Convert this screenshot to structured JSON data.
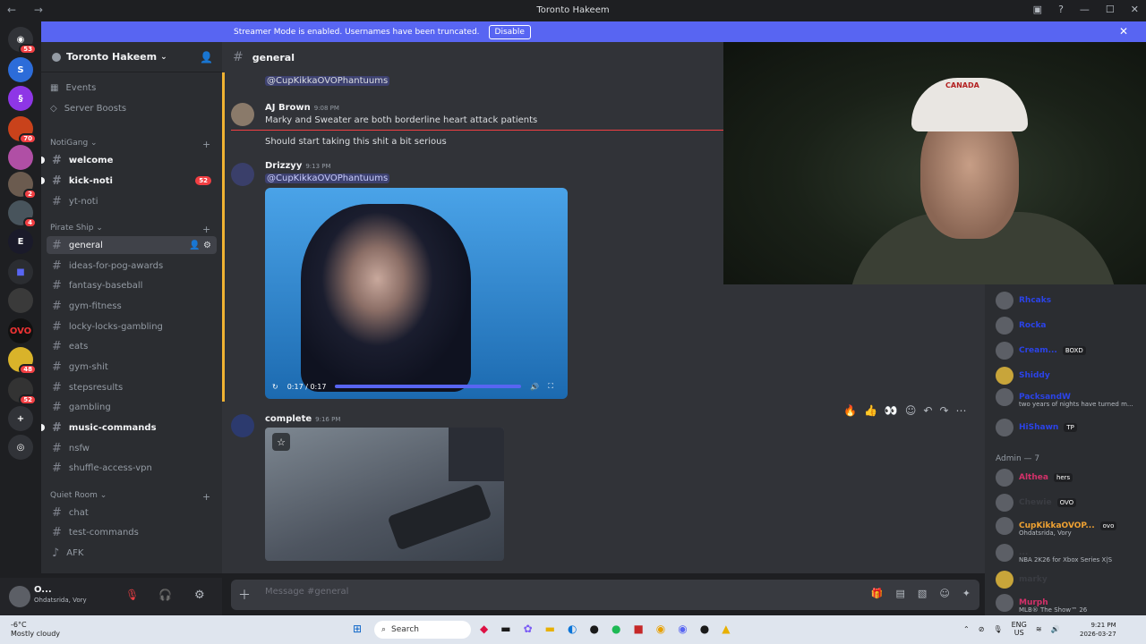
{
  "window": {
    "title": "Toronto Hakeem"
  },
  "banner": {
    "text": "Streamer Mode is enabled. Usernames have been truncated.",
    "button": "Disable"
  },
  "rail": {
    "badges": [
      "53",
      "70",
      "2",
      "4",
      "48",
      "52"
    ]
  },
  "sidebar": {
    "server_name": "Toronto Hakeem",
    "top_items": [
      "Events",
      "Server Boosts"
    ],
    "categories": [
      {
        "name": "NotiGang",
        "channels": [
          {
            "name": "welcome",
            "unread": true
          },
          {
            "name": "kick-noti",
            "unread": true,
            "badge": "52"
          },
          {
            "name": "yt-noti"
          }
        ]
      },
      {
        "name": "Pirate Ship",
        "channels": [
          {
            "name": "general",
            "active": true
          },
          {
            "name": "ideas-for-pog-awards"
          },
          {
            "name": "fantasy-baseball"
          },
          {
            "name": "gym-fitness"
          },
          {
            "name": "locky-locks-gambling"
          },
          {
            "name": "eats"
          },
          {
            "name": "gym-shit"
          },
          {
            "name": "stepsresults"
          },
          {
            "name": "gambling"
          },
          {
            "name": "music-commands",
            "unread": true
          },
          {
            "name": "nsfw"
          },
          {
            "name": "shuffle-access-vpn"
          }
        ]
      },
      {
        "name": "Quiet Room",
        "channels": [
          {
            "name": "chat"
          },
          {
            "name": "test-commands"
          },
          {
            "name": "AFK"
          }
        ]
      }
    ]
  },
  "user": {
    "name": "O...",
    "status": "Ohdatsrida, Vory"
  },
  "chat": {
    "channel": "general",
    "messages": [
      {
        "mention": "@CupKikkaOVOPhantuums"
      },
      {
        "author": "AJ Brown",
        "time": "9:08 PM",
        "lines": [
          "Marky and Sweater are both borderline heart attack patients",
          "Should start taking this shit a bit serious"
        ]
      },
      {
        "author": "Drizzyy",
        "time": "9:13 PM",
        "mention": "@CupKikkaOVOPhantuums",
        "video_time": "0:17 / 0:17"
      },
      {
        "author": "complete",
        "time": "9:16 PM"
      }
    ],
    "composer_placeholder": "Message #general"
  },
  "webcam": {
    "cap_text": "CANADA"
  },
  "members": {
    "top": [
      {
        "name": "Rhcaks",
        "color": "#2b43e8"
      },
      {
        "name": "Rocka",
        "color": "#2b43e8"
      },
      {
        "name": "Cream...",
        "color": "#2b43e8",
        "tag": "BOXD"
      },
      {
        "name": "Shiddy",
        "color": "#2b43e8"
      },
      {
        "name": "PacksandW",
        "color": "#2b43e8",
        "sub": "two years of nights have turned m..."
      },
      {
        "name": "HiShawn",
        "color": "#2b43e8",
        "tag": "TP"
      }
    ],
    "admin_header": "Admin — 7",
    "admins": [
      {
        "name": "Althea",
        "color": "#d4316a",
        "tag": "hers"
      },
      {
        "name": "Chewie",
        "color": "#3a3c42",
        "tag": "OVO"
      },
      {
        "name": "CupKikkaOVOP...",
        "color": "#f0a232",
        "tag": "ovo",
        "sub": "Ohdatsrida, Vory"
      },
      {
        "name": "...",
        "color": "#3a3c42",
        "sub": "NBA 2K26 for Xbox Series X|S"
      },
      {
        "name": "marky",
        "color": "#3a3c42"
      },
      {
        "name": "Murph",
        "color": "#d4316a",
        "sub": "MLB® The Show™ 26"
      }
    ]
  },
  "taskbar": {
    "weather_temp": "-6°C",
    "weather_desc": "Mostly cloudy",
    "search": "Search",
    "lang": "ENG",
    "region": "US",
    "time": "9:21 PM",
    "date": "2026-03-27"
  }
}
